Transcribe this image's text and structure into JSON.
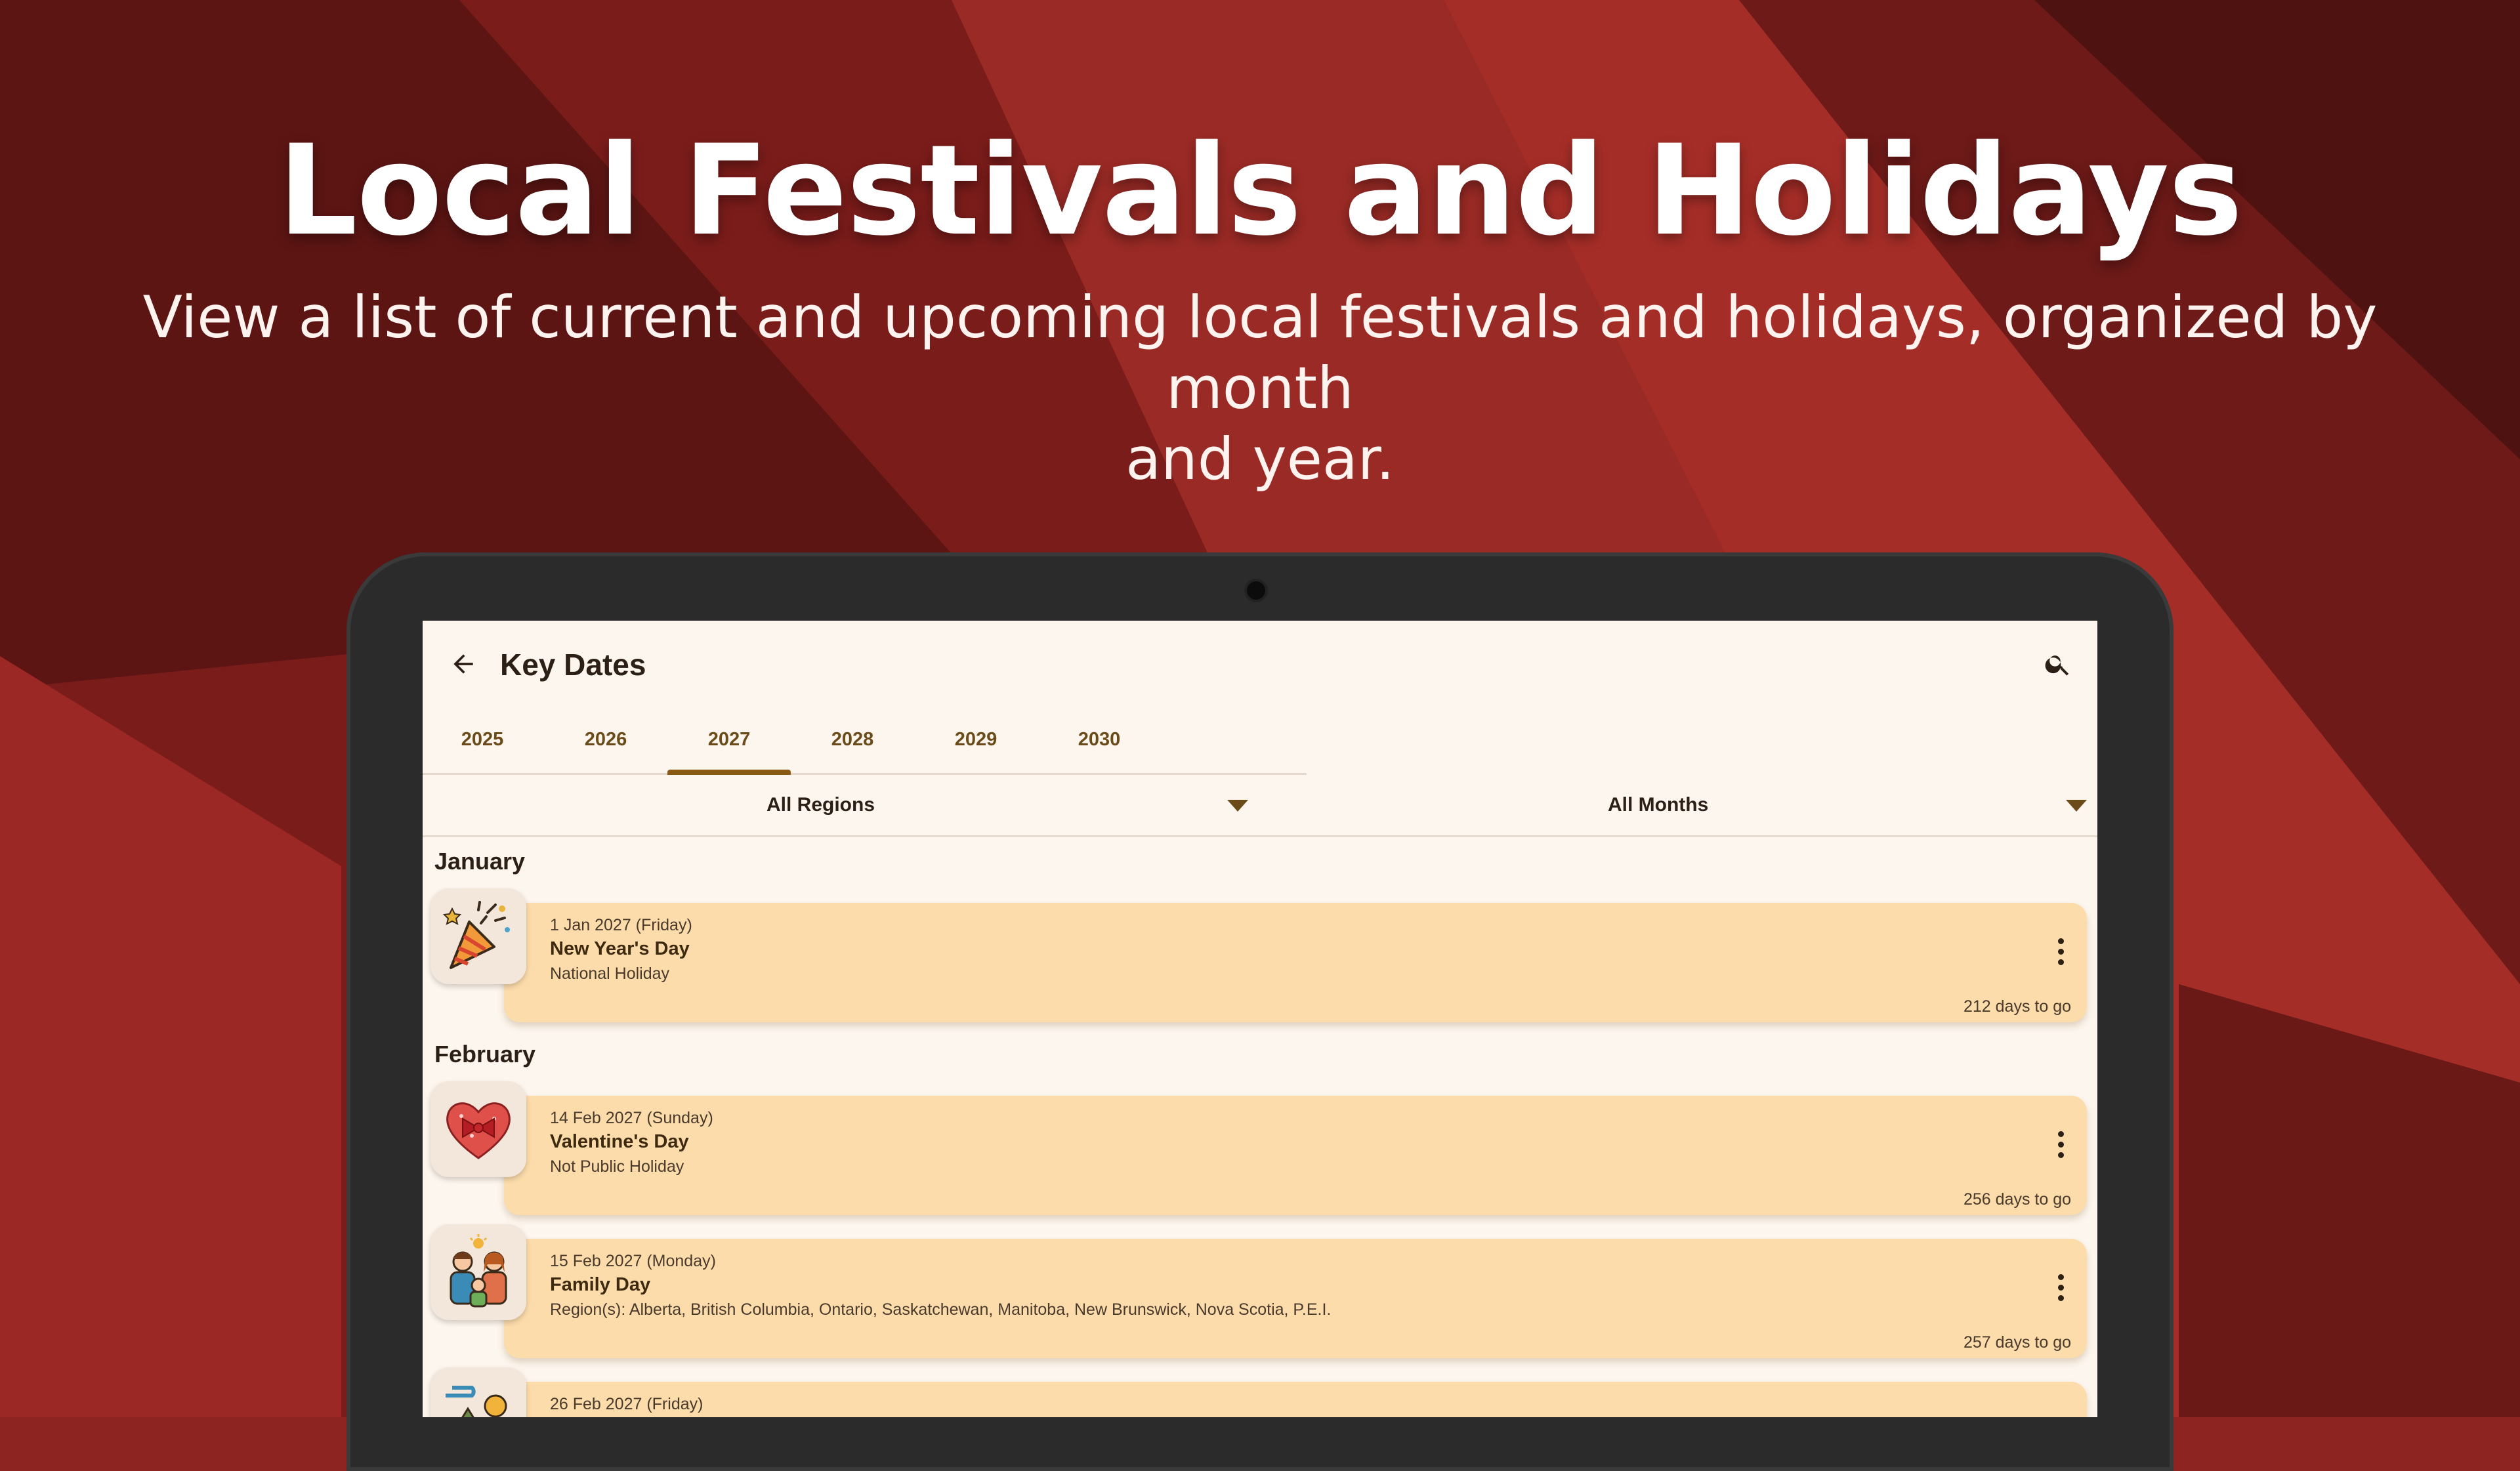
{
  "hero": {
    "title": "Local Festivals and Holidays",
    "subtitle_line1": "View a list of current and upcoming local festivals and holidays, organized by month",
    "subtitle_line2": "and year."
  },
  "appbar": {
    "title": "Key Dates",
    "back_icon": "arrow-left-icon",
    "search_icon": "search-icon"
  },
  "tabs": [
    {
      "label": "2025",
      "active": false
    },
    {
      "label": "2026",
      "active": false
    },
    {
      "label": "2027",
      "active": true
    },
    {
      "label": "2028",
      "active": false
    },
    {
      "label": "2029",
      "active": false
    },
    {
      "label": "2030",
      "active": false
    }
  ],
  "filters": {
    "region": "All Regions",
    "month": "All Months"
  },
  "sections": [
    {
      "month": "January",
      "events": [
        {
          "date": "1 Jan 2027 (Friday)",
          "name": "New Year's Day",
          "type": "National Holiday",
          "days_to_go": "212 days to go",
          "icon": "party-popper-icon"
        }
      ]
    },
    {
      "month": "February",
      "events": [
        {
          "date": "14 Feb 2027 (Sunday)",
          "name": "Valentine's Day",
          "type": "Not Public Holiday",
          "days_to_go": "256 days to go",
          "icon": "heart-gift-icon"
        },
        {
          "date": "15 Feb 2027 (Monday)",
          "name": "Family Day",
          "type": "Region(s): Alberta, British Columbia, Ontario, Saskatchewan, Manitoba, New Brunswick, Nova Scotia, P.E.I.",
          "days_to_go": "257 days to go",
          "icon": "family-icon"
        },
        {
          "date": "26 Feb 2027 (Friday)",
          "name": "",
          "type": "",
          "days_to_go": "",
          "icon": "landscape-icon"
        }
      ]
    }
  ],
  "colors": {
    "background": "#8e2421",
    "screen": "#fdf6ee",
    "card": "#fcdcab",
    "tab_indicator": "#8a5a12"
  }
}
